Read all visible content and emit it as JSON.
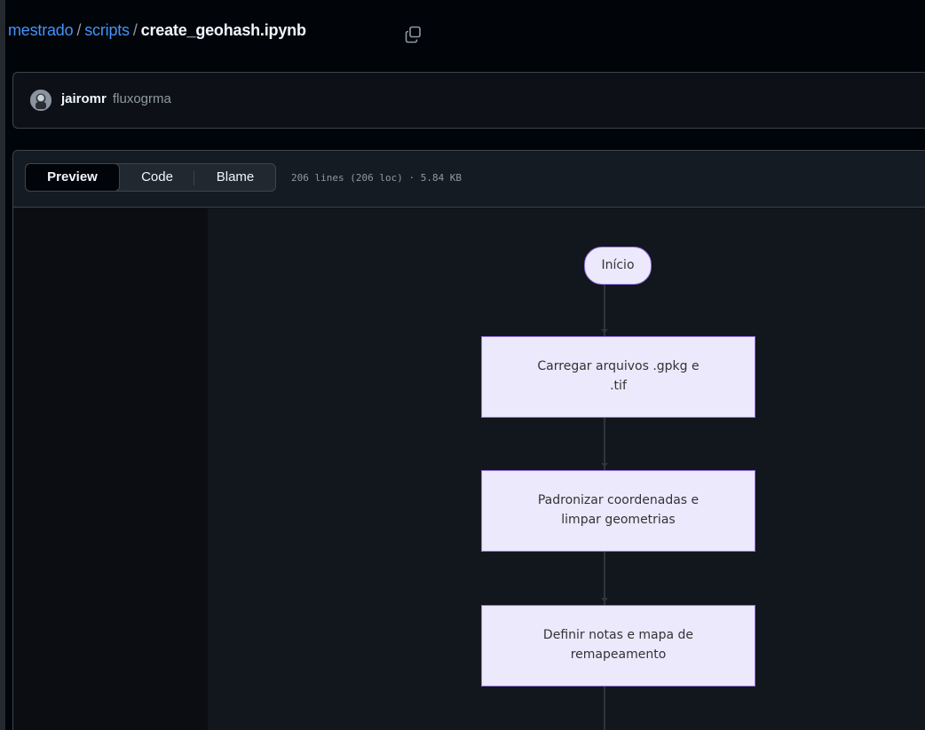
{
  "breadcrumb": {
    "repo": "mestrado",
    "sep1": "/",
    "folder": "scripts",
    "sep2": "/",
    "file": "create_geohash.ipynb"
  },
  "commit": {
    "author": "jairomr",
    "message": "fluxogrma"
  },
  "file_header": {
    "tabs": [
      "Preview",
      "Code",
      "Blame"
    ],
    "active_tab": "Preview",
    "info": "206 lines (206 loc) · 5.84 KB"
  },
  "flowchart": {
    "start_label": "Início",
    "steps": [
      {
        "line1": "Carregar arquivos .gpkg e",
        "line2": ".tif"
      },
      {
        "line1": "Padronizar coordenadas e",
        "line2": "limpar geometrias"
      },
      {
        "line1": "Definir notas e mapa de",
        "line2": "remapeamento"
      }
    ],
    "colors": {
      "node_fill": "#ece9fd",
      "node_border": "#9370db",
      "edge": "#2f353c"
    }
  },
  "colors": {
    "link": "#4493f8",
    "background": "#010409",
    "panel": "#0d1117"
  }
}
